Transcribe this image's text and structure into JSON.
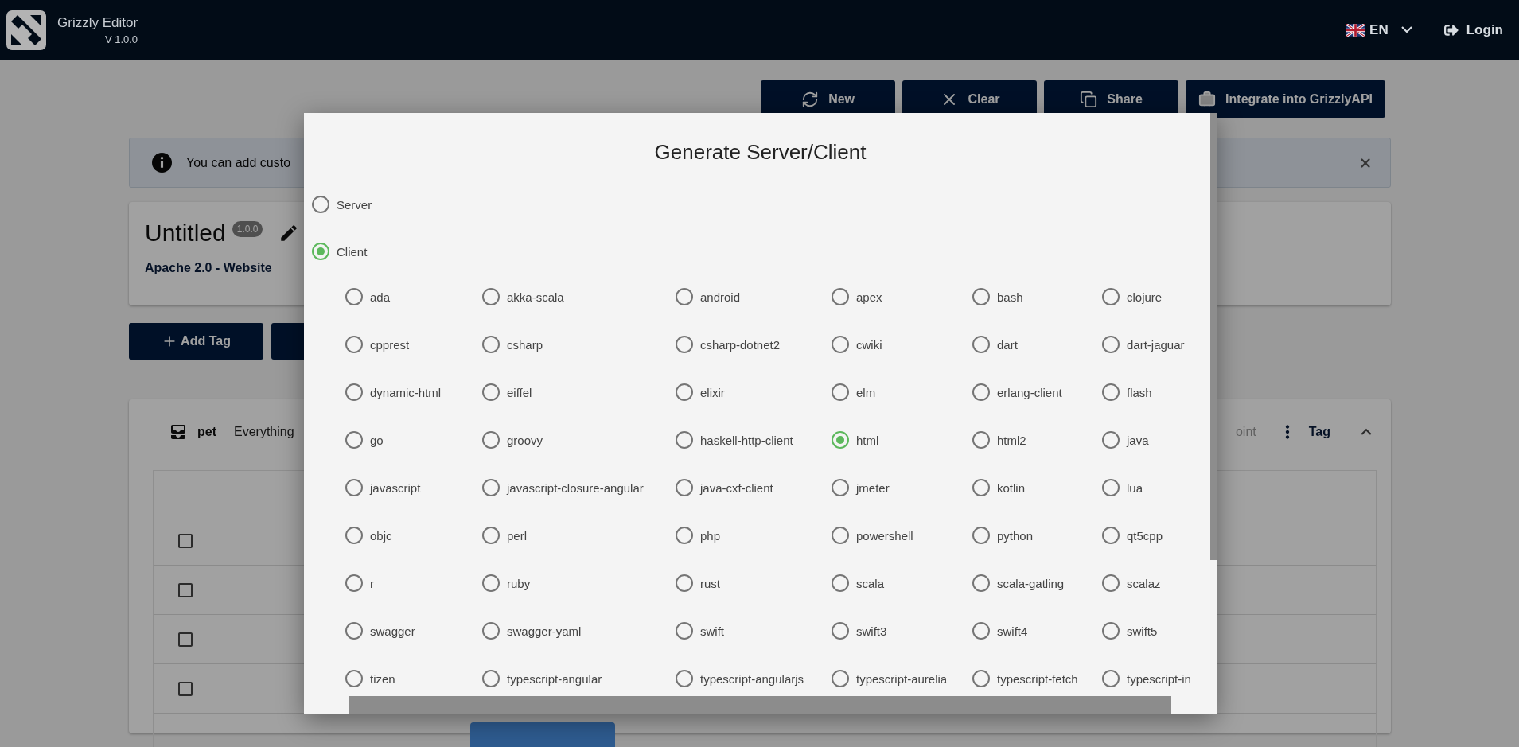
{
  "header": {
    "app_name": "Grizzly Editor",
    "version": "V 1.0.0",
    "language": "EN",
    "login": "Login"
  },
  "toolbar": [
    {
      "kind": "new",
      "label": "New"
    },
    {
      "kind": "clear",
      "label": "Clear"
    },
    {
      "kind": "share",
      "label": "Share"
    },
    {
      "kind": "integrate",
      "label": "Integrate into GrizzlyAPI"
    }
  ],
  "alert": {
    "text": "You can add custo"
  },
  "project": {
    "title": "Untitled",
    "version": "1.0.0",
    "license": "Apache 2.0 - Website"
  },
  "actions": [
    {
      "label": "Add Tag"
    }
  ],
  "tag_panel": {
    "name": "pet",
    "description": "Everything",
    "endpoint_hint": "oint",
    "tag_button": "Tag",
    "expanded": true,
    "rows": [
      {
        "checked": false
      },
      {
        "checked": false
      },
      {
        "checked": false
      },
      {
        "checked": false
      }
    ]
  },
  "dialog": {
    "title": "Generate Server/Client",
    "modes": [
      {
        "label": "Server",
        "selected": false
      },
      {
        "label": "Client",
        "selected": true
      }
    ],
    "languages": [
      {
        "label": "ada",
        "selected": false
      },
      {
        "label": "akka-scala",
        "selected": false
      },
      {
        "label": "android",
        "selected": false
      },
      {
        "label": "apex",
        "selected": false
      },
      {
        "label": "bash",
        "selected": false
      },
      {
        "label": "clojure",
        "selected": false
      },
      {
        "label": "cpprest",
        "selected": false
      },
      {
        "label": "csharp",
        "selected": false
      },
      {
        "label": "csharp-dotnet2",
        "selected": false
      },
      {
        "label": "cwiki",
        "selected": false
      },
      {
        "label": "dart",
        "selected": false
      },
      {
        "label": "dart-jaguar",
        "selected": false
      },
      {
        "label": "dynamic-html",
        "selected": false
      },
      {
        "label": "eiffel",
        "selected": false
      },
      {
        "label": "elixir",
        "selected": false
      },
      {
        "label": "elm",
        "selected": false
      },
      {
        "label": "erlang-client",
        "selected": false
      },
      {
        "label": "flash",
        "selected": false
      },
      {
        "label": "go",
        "selected": false
      },
      {
        "label": "groovy",
        "selected": false
      },
      {
        "label": "haskell-http-client",
        "selected": false
      },
      {
        "label": "html",
        "selected": true
      },
      {
        "label": "html2",
        "selected": false
      },
      {
        "label": "java",
        "selected": false
      },
      {
        "label": "javascript",
        "selected": false
      },
      {
        "label": "javascript-closure-angular",
        "selected": false
      },
      {
        "label": "java-cxf-client",
        "selected": false
      },
      {
        "label": "jmeter",
        "selected": false
      },
      {
        "label": "kotlin",
        "selected": false
      },
      {
        "label": "lua",
        "selected": false
      },
      {
        "label": "objc",
        "selected": false
      },
      {
        "label": "perl",
        "selected": false
      },
      {
        "label": "php",
        "selected": false
      },
      {
        "label": "powershell",
        "selected": false
      },
      {
        "label": "python",
        "selected": false
      },
      {
        "label": "qt5cpp",
        "selected": false
      },
      {
        "label": "r",
        "selected": false
      },
      {
        "label": "ruby",
        "selected": false
      },
      {
        "label": "rust",
        "selected": false
      },
      {
        "label": "scala",
        "selected": false
      },
      {
        "label": "scala-gatling",
        "selected": false
      },
      {
        "label": "scalaz",
        "selected": false
      },
      {
        "label": "swagger",
        "selected": false
      },
      {
        "label": "swagger-yaml",
        "selected": false
      },
      {
        "label": "swift",
        "selected": false
      },
      {
        "label": "swift3",
        "selected": false
      },
      {
        "label": "swift4",
        "selected": false
      },
      {
        "label": "swift5",
        "selected": false
      },
      {
        "label": "tizen",
        "selected": false
      },
      {
        "label": "typescript-angular",
        "selected": false
      },
      {
        "label": "typescript-angularjs",
        "selected": false
      },
      {
        "label": "typescript-aurelia",
        "selected": false
      },
      {
        "label": "typescript-fetch",
        "selected": false
      },
      {
        "label": "typescript-in",
        "selected": false
      }
    ]
  }
}
